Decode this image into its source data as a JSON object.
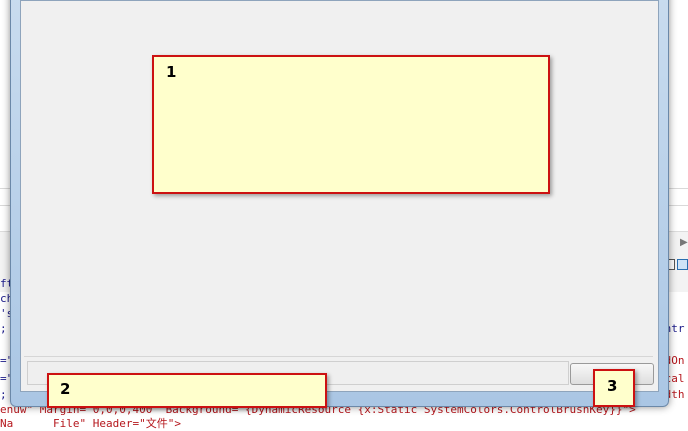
{
  "background_editor": {
    "left_code_lines": [
      "ft_",
      "che",
      "'sc",
      "; S",
      "=\"t",
      "=\"t",
      "; Se",
      "enuw",
      "Na"
    ],
    "right_code_lines": [
      "ontr",
      "adOn",
      "ical",
      "idth"
    ],
    "bottom_line": "enuw\" Margin=\"0,0,0,400\" Background=\"{DynamicResource {x:Static SystemColors.ControlBrushKey}}\">",
    "last_line_fragment": "Na      File\" Header=\"文件\">"
  },
  "callouts": {
    "callout_1": "1",
    "callout_2": "2",
    "callout_3": "3"
  },
  "colors": {
    "callout_fill": "#ffffcc",
    "callout_border": "#cc1111",
    "window_chrome": "#c9dcef",
    "client_area": "#f0f0f0"
  }
}
